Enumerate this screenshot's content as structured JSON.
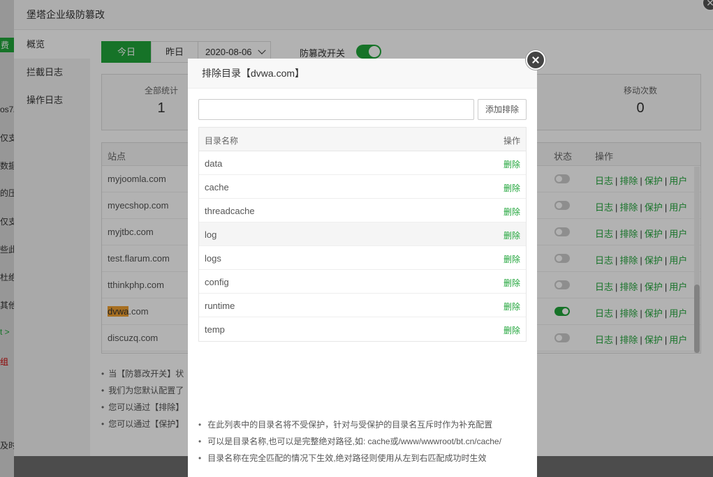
{
  "background_strip": {
    "items": [
      "费",
      "os7/",
      "仅支",
      "数据",
      "的压",
      "仅支",
      "些此",
      "杜绝",
      "其他",
      "t >",
      "组",
      "",
      "及时"
    ]
  },
  "outer_dialog": {
    "title": "堡塔企业级防篡改",
    "close_label": "✕",
    "sidebar": [
      "概览",
      "拦截日志",
      "操作日志"
    ],
    "date_buttons": {
      "today": "今日",
      "yesterday": "昨日",
      "date_value": "2020-08-06"
    },
    "tamper_switch_label": "防篡改开关",
    "tamper_switch_on": true,
    "stats": [
      {
        "label": "全部统计",
        "value": "1"
      },
      {
        "label": "移动次数",
        "value": "0"
      }
    ],
    "site_table": {
      "headers": {
        "site": "站点",
        "status": "状态",
        "ops": "操作"
      },
      "op_labels": [
        "日志",
        "排除",
        "保护",
        "用户"
      ],
      "rows": [
        {
          "pre": "",
          "hl": "",
          "name": "myjoomla.com",
          "on": false
        },
        {
          "pre": "",
          "hl": "",
          "name": "myecshop.com",
          "on": false
        },
        {
          "pre": "",
          "hl": "",
          "name": "myjtbc.com",
          "on": false
        },
        {
          "pre": "",
          "hl": "",
          "name": "test.flarum.com",
          "on": false
        },
        {
          "pre": "",
          "hl": "",
          "name": "tthinkphp.com",
          "on": false
        },
        {
          "pre": "",
          "hl": "dvwa",
          "name": ".com",
          "on": true
        },
        {
          "pre": "",
          "hl": "",
          "name": "discuzq.com",
          "on": false
        }
      ]
    },
    "notes": [
      "当【防篡改开关】状",
      "我们为您默认配置了",
      "您可以通过【排除】",
      "您可以通过【保护】"
    ]
  },
  "modal": {
    "title": "排除目录【dvwa.com】",
    "input_value": "",
    "input_placeholder": "",
    "add_button": "添加排除",
    "table_headers": {
      "name": "目录名称",
      "action": "操作"
    },
    "delete_label": "删除",
    "dirs": [
      "data",
      "cache",
      "threadcache",
      "log",
      "logs",
      "config",
      "runtime",
      "temp"
    ],
    "notes": [
      "在此列表中的目录名将不受保护，针对与受保护的目录名互斥时作为补充配置",
      "可以是目录名称,也可以是完整绝对路径,如: cache或/www/wwwroot/bt.cn/cache/",
      "目录名称在完全匹配的情况下生效,绝对路径则使用从左到右匹配成功时生效"
    ]
  },
  "colors": {
    "accent": "#20a53a",
    "highlight": "#f0a030"
  }
}
